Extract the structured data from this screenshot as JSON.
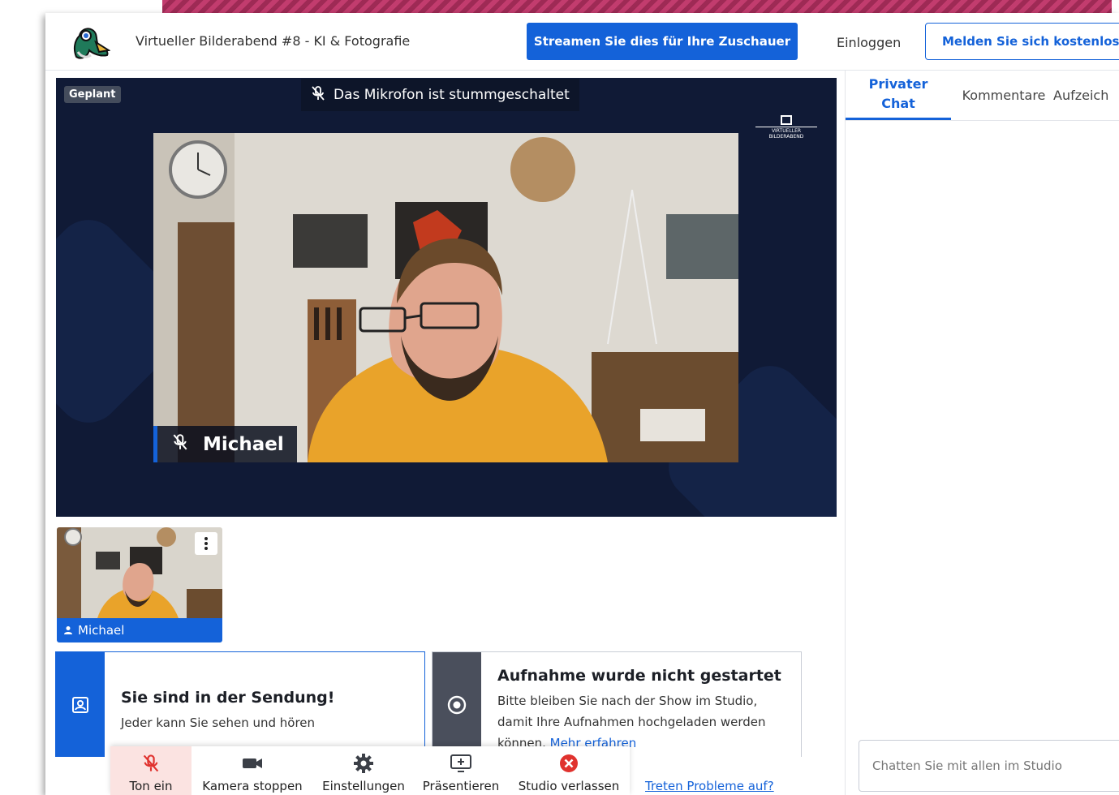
{
  "header": {
    "title": "Virtueller Bilderabend #8 - KI & Fotografie",
    "stream_button": "Streamen Sie dies für Ihre Zuschauer",
    "login": "Einloggen",
    "signup_button": "Melden Sie sich kostenlos a"
  },
  "stage": {
    "status_badge": "Geplant",
    "mute_banner": "Das Mikrofon ist stummgeschaltet",
    "brand_mark": "VIRTUELLER BILDERABEND",
    "main_participant": "Michael"
  },
  "thumbnail": {
    "name": "Michael"
  },
  "cards": {
    "on_air": {
      "title": "Sie sind in der Sendung!",
      "text": "Jeder kann Sie sehen und hören"
    },
    "recording": {
      "title": "Aufnahme wurde nicht gestartet",
      "text_line1": "Bitte bleiben Sie nach der Show im Studio,",
      "text_line2": "damit Ihre Aufnahmen hochgeladen werden",
      "text_line3": "können.",
      "link": "Mehr erfahren"
    }
  },
  "toolbar": {
    "unmute": "Ton ein",
    "stop_camera": "Kamera stoppen",
    "settings": "Einstellungen",
    "present": "Präsentieren",
    "leave": "Studio verlassen",
    "problems_link": "Treten Probleme auf?"
  },
  "panel": {
    "tabs": [
      "Privater Chat",
      "Kommentare",
      "Aufzeich"
    ],
    "chat_placeholder": "Chatten Sie mit allen im Studio"
  },
  "colors": {
    "accent": "#1462d9",
    "stage_bg": "#101a36",
    "leave_red": "#e0322e"
  }
}
